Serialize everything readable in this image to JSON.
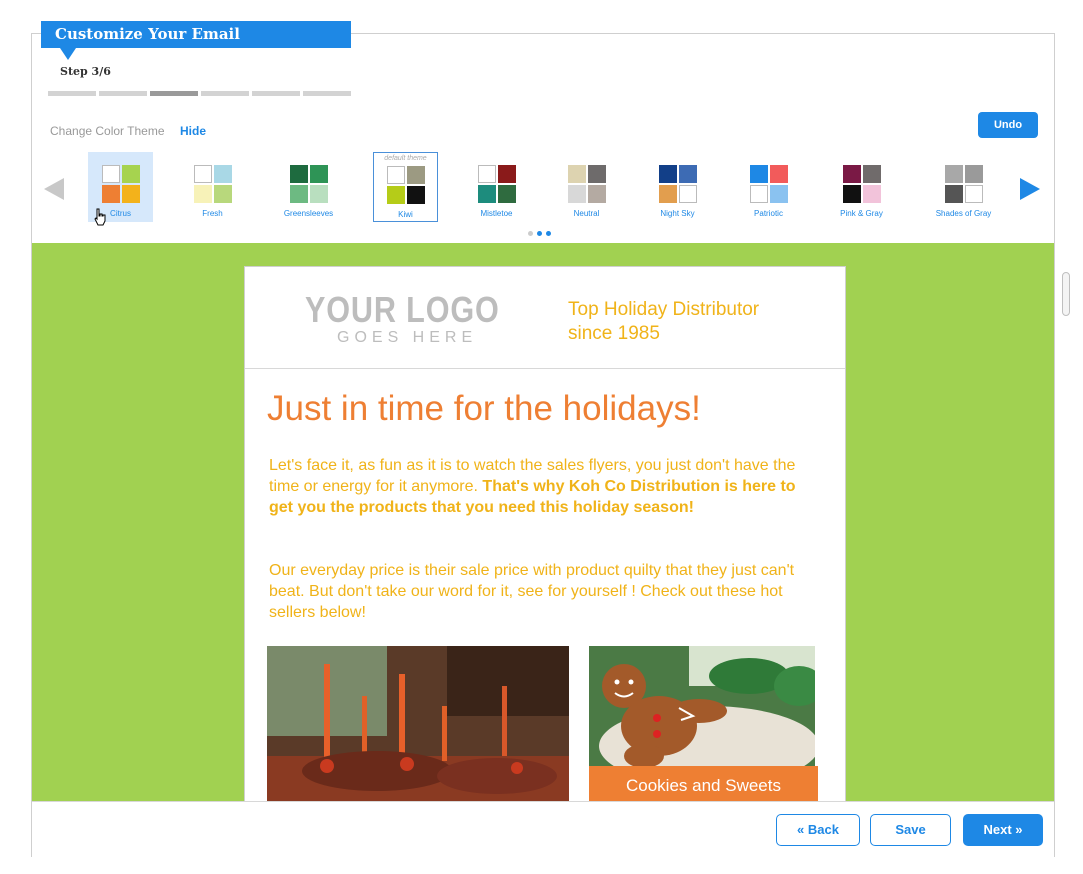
{
  "header": {
    "title": "Customize Your Email",
    "step": "Step 3/6",
    "progress": {
      "total": 6,
      "current": 3
    }
  },
  "theme_bar": {
    "label": "Change Color Theme",
    "hide_label": "Hide",
    "undo_label": "Undo",
    "default_tag": "default theme",
    "themes": [
      {
        "name": "Citrus",
        "colors": [
          "#ffffff",
          "#a6d34f",
          "#ee7f33",
          "#f3b21b"
        ]
      },
      {
        "name": "Fresh",
        "colors": [
          "#ffffff",
          "#a9d8e6",
          "#f7f2b8",
          "#b8d87c"
        ]
      },
      {
        "name": "Greensleeves",
        "colors": [
          "#1e6b3f",
          "#2e9456",
          "#6dba82",
          "#b9dfbf"
        ]
      },
      {
        "name": "Kiwi",
        "colors": [
          "#ffffff",
          "#9c9a82",
          "#b5cc18",
          "#111111"
        ]
      },
      {
        "name": "Mistletoe",
        "colors": [
          "#ffffff",
          "#8a1a1a",
          "#1d8c7d",
          "#2f6b3f"
        ]
      },
      {
        "name": "Neutral",
        "colors": [
          "#ddd3b0",
          "#6e6b6b",
          "#d8d8d8",
          "#b4aaa2"
        ]
      },
      {
        "name": "Night Sky",
        "colors": [
          "#123f88",
          "#3d6bb4",
          "#e29e4e",
          "#ffffff"
        ]
      },
      {
        "name": "Patriotic",
        "colors": [
          "#1e88e5",
          "#f25b5b",
          "#ffffff",
          "#8ac2f0"
        ]
      },
      {
        "name": "Pink & Gray",
        "colors": [
          "#7a1945",
          "#706b6b",
          "#111111",
          "#f2c3da"
        ]
      },
      {
        "name": "Shades of Gray",
        "colors": [
          "#a8a8a8",
          "#9a9a9a",
          "#555555",
          "#ffffff"
        ]
      }
    ]
  },
  "email": {
    "logo_main": "YOUR LOGO",
    "logo_sub": "GOES HERE",
    "tagline_line1": "Top Holiday Distributor",
    "tagline_line2": "since 1985",
    "headline": "Just in time for the holidays!",
    "p1_text": "Let's face it, as fun as it is to watch the sales flyers, you just don't have the time or energy for it anymore. ",
    "p1_bold": "That's why Koh Co Distribution is here to get you the products that you need this holiday season!",
    "p2_text": "Our everyday price is their sale price with product quilty that they just can't beat. But don't take our word for it, see for yourself ! Check out these hot sellers below!",
    "caption": "Cookies and Sweets"
  },
  "footer": {
    "back_label": "« Back",
    "save_label": "Save",
    "next_label": "Next »"
  }
}
